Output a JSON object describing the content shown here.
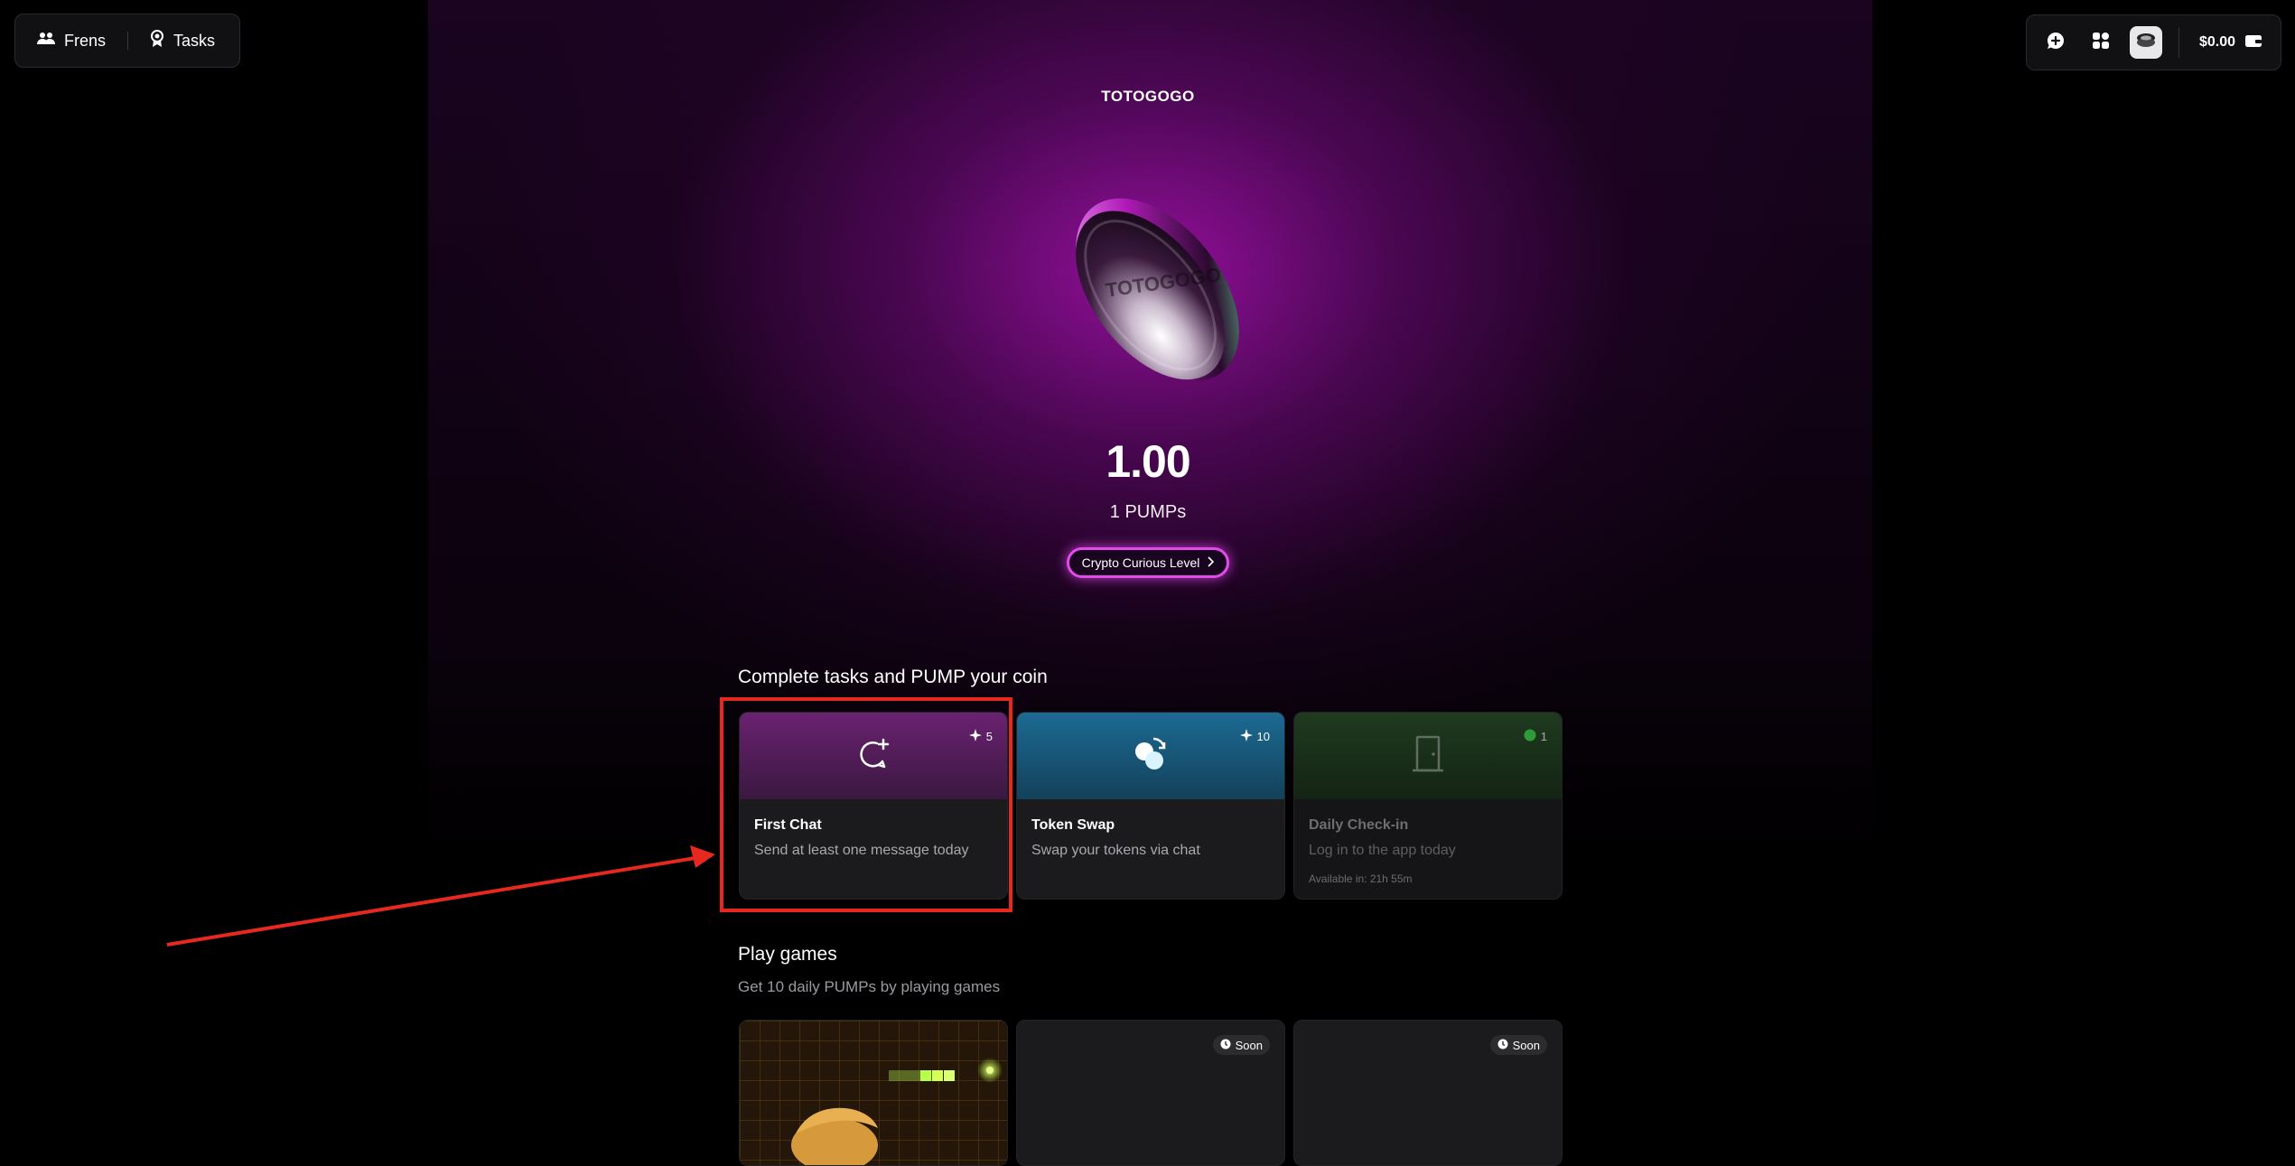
{
  "nav": {
    "frens_label": "Frens",
    "tasks_label": "Tasks",
    "balance": "$0.00"
  },
  "hero": {
    "coin_name": "TOTOGOGO",
    "amount": "1.00",
    "pumps": "1 PUMPs",
    "level_label": "Crypto Curious Level"
  },
  "tasks": {
    "title": "Complete tasks and PUMP your coin",
    "items": [
      {
        "title": "First Chat",
        "desc": "Send at least one message today",
        "badge": "5",
        "icon": "chat-plus-icon"
      },
      {
        "title": "Token Swap",
        "desc": "Swap your tokens via chat",
        "badge": "10",
        "icon": "swap-coins-icon"
      },
      {
        "title": "Daily Check-in",
        "desc": "Log in to the app today",
        "badge": "1",
        "available": "Available in: 21h 55m",
        "icon": "door-icon"
      }
    ]
  },
  "games": {
    "title": "Play games",
    "subtitle": "Get 10 daily PUMPs by playing games",
    "soon_label": "Soon"
  },
  "colors": {
    "accent": "#e14bea",
    "highlight": "#e6281e"
  }
}
